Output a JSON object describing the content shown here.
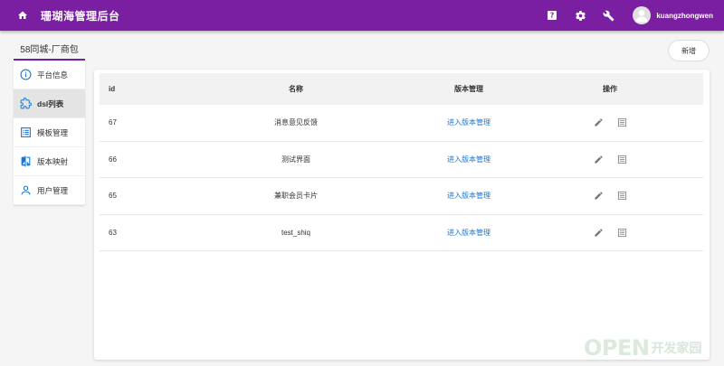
{
  "app": {
    "title": "珊瑚海管理后台",
    "username": "kuangzhongwen"
  },
  "colors": {
    "brand": "#7b1fa2",
    "link": "#1976d2",
    "active_bg": "#e4e4e4"
  },
  "sidebar": {
    "header": "58同城-厂商包",
    "items": [
      {
        "label": "平台信息",
        "icon": "info-icon",
        "active": false
      },
      {
        "label": "dsl列表",
        "icon": "puzzle-icon",
        "active": true
      },
      {
        "label": "模板管理",
        "icon": "list-icon",
        "active": false
      },
      {
        "label": "版本映射",
        "icon": "compare-icon",
        "active": false
      },
      {
        "label": "用户管理",
        "icon": "person-icon",
        "active": false
      }
    ]
  },
  "toolbar": {
    "add_label": "新增"
  },
  "table": {
    "headers": {
      "id": "id",
      "name": "名称",
      "version": "版本管理",
      "ops": "操作"
    },
    "rows": [
      {
        "id": "67",
        "name": "消息意见反馈",
        "version_link": "进入版本管理"
      },
      {
        "id": "66",
        "name": "测试界面",
        "version_link": "进入版本管理"
      },
      {
        "id": "65",
        "name": "兼职会员卡片",
        "version_link": "进入版本管理"
      },
      {
        "id": "63",
        "name": "test_shiq",
        "version_link": "进入版本管理"
      }
    ]
  },
  "watermark": {
    "brand": "OPEN",
    "text": "开发家园"
  }
}
